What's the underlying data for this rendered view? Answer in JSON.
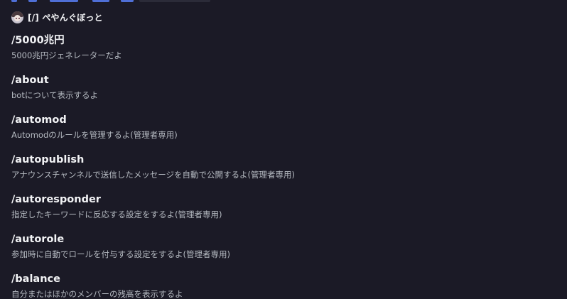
{
  "app": {
    "name": "[/] ぺやんぐぼっと",
    "avatar_icon": "bot-avatar-icon"
  },
  "theme": {
    "background": "#1b1a26",
    "title_color": "#f2f3f5",
    "description_color": "#b5bac1",
    "accent": "#4f6fd6"
  },
  "commands": [
    {
      "name": "/5000兆円",
      "description": "5000兆円ジェネレーターだよ"
    },
    {
      "name": "/about",
      "description": "botについて表示するよ"
    },
    {
      "name": "/automod",
      "description": "Automodのルールを管理するよ(管理者専用)"
    },
    {
      "name": "/autopublish",
      "description": "アナウンスチャンネルで送信したメッセージを自動で公開するよ(管理者専用)"
    },
    {
      "name": "/autoresponder",
      "description": "指定したキーワードに反応する設定をするよ(管理者専用)"
    },
    {
      "name": "/autorole",
      "description": "参加時に自動でロールを付与する設定をするよ(管理者専用)"
    },
    {
      "name": "/balance",
      "description": "自分またはほかのメンバーの残高を表示するよ"
    }
  ]
}
